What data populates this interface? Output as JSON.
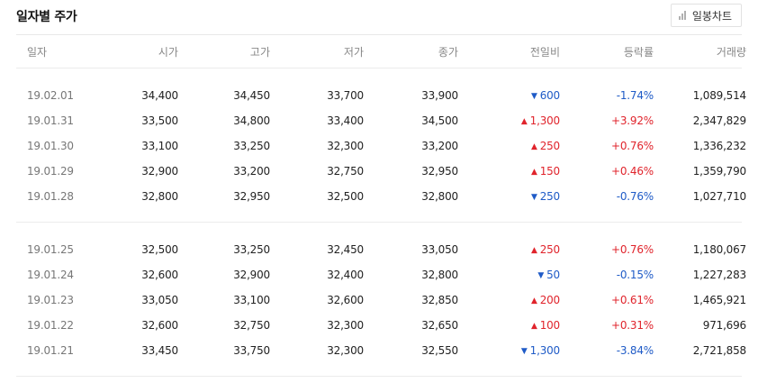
{
  "header": {
    "title": "일자별 주가",
    "chart_button_label": "일봉차트"
  },
  "columns": [
    "일자",
    "시가",
    "고가",
    "저가",
    "종가",
    "전일비",
    "등락률",
    "거래량"
  ],
  "groups": [
    {
      "rows": [
        {
          "date": "19.02.01",
          "open": "34,400",
          "high": "34,450",
          "low": "33,700",
          "close": "33,900",
          "dir": "down",
          "change": "600",
          "rate": "-1.74%",
          "volume": "1,089,514"
        },
        {
          "date": "19.01.31",
          "open": "33,500",
          "high": "34,800",
          "low": "33,400",
          "close": "34,500",
          "dir": "up",
          "change": "1,300",
          "rate": "+3.92%",
          "volume": "2,347,829"
        },
        {
          "date": "19.01.30",
          "open": "33,100",
          "high": "33,250",
          "low": "32,300",
          "close": "33,200",
          "dir": "up",
          "change": "250",
          "rate": "+0.76%",
          "volume": "1,336,232"
        },
        {
          "date": "19.01.29",
          "open": "32,900",
          "high": "33,200",
          "low": "32,750",
          "close": "32,950",
          "dir": "up",
          "change": "150",
          "rate": "+0.46%",
          "volume": "1,359,790"
        },
        {
          "date": "19.01.28",
          "open": "32,800",
          "high": "32,950",
          "low": "32,500",
          "close": "32,800",
          "dir": "down",
          "change": "250",
          "rate": "-0.76%",
          "volume": "1,027,710"
        }
      ]
    },
    {
      "rows": [
        {
          "date": "19.01.25",
          "open": "32,500",
          "high": "33,250",
          "low": "32,450",
          "close": "33,050",
          "dir": "up",
          "change": "250",
          "rate": "+0.76%",
          "volume": "1,180,067"
        },
        {
          "date": "19.01.24",
          "open": "32,600",
          "high": "32,900",
          "low": "32,400",
          "close": "32,800",
          "dir": "down",
          "change": "50",
          "rate": "-0.15%",
          "volume": "1,227,283"
        },
        {
          "date": "19.01.23",
          "open": "33,050",
          "high": "33,100",
          "low": "32,600",
          "close": "32,850",
          "dir": "up",
          "change": "200",
          "rate": "+0.61%",
          "volume": "1,465,921"
        },
        {
          "date": "19.01.22",
          "open": "32,600",
          "high": "32,750",
          "low": "32,300",
          "close": "32,650",
          "dir": "up",
          "change": "100",
          "rate": "+0.31%",
          "volume": "971,696"
        },
        {
          "date": "19.01.21",
          "open": "33,450",
          "high": "33,750",
          "low": "32,300",
          "close": "32,550",
          "dir": "down",
          "change": "1,300",
          "rate": "-3.84%",
          "volume": "2,721,858"
        }
      ]
    }
  ],
  "colors": {
    "up": "#e0242c",
    "down": "#1f5bc7"
  },
  "icons": {
    "up": "triangle-up-icon",
    "down": "triangle-down-icon"
  }
}
